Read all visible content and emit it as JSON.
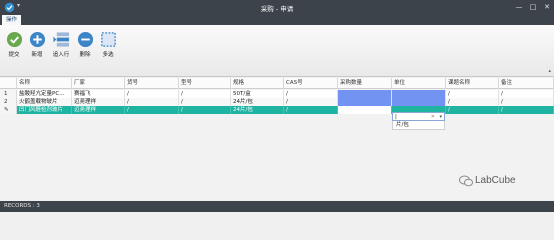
{
  "window": {
    "title": "采购 - 申请",
    "menu_caret": "▾"
  },
  "tabs": [
    {
      "label": "操作"
    }
  ],
  "toolbar": {
    "buttons": [
      {
        "label": "提交",
        "icon": "check-circle-icon",
        "color": "#6aa84f"
      },
      {
        "label": "新增",
        "icon": "plus-circle-icon",
        "color": "#3d85c6"
      },
      {
        "label": "追入行",
        "icon": "insert-row-icon",
        "color": "#3d85c6"
      },
      {
        "label": "删除",
        "icon": "minus-circle-icon",
        "color": "#3d85c6"
      },
      {
        "label": "多选",
        "icon": "multi-select-icon",
        "color": "#3d85c6"
      }
    ]
  },
  "table": {
    "columns": [
      "名称",
      "厂家",
      "货号",
      "型号",
      "规格",
      "CAS号",
      "采购数量",
      "单位",
      "课题名称",
      "备注"
    ],
    "rows": [
      {
        "num": "1",
        "cells": [
          "盐酸羟亢定量PC...",
          "赛福飞",
          "/",
          "/",
          "50T/盒",
          "/",
          "",
          "",
          "/",
          "/"
        ]
      },
      {
        "num": "2",
        "cells": [
          "火鹤盖载物玻片",
          "迈尧理祥",
          "/",
          "/",
          "24片/包",
          "/",
          "",
          "",
          "/",
          "/"
        ]
      },
      {
        "num": "✎",
        "cells": [
          "凹门风醛检剂玻片",
          "迈尧理祥",
          "/",
          "/",
          "24片/包",
          "/",
          "",
          "",
          "/",
          "/"
        ]
      }
    ],
    "selected_row_index": 2
  },
  "unit_dropdown": {
    "value": "|",
    "clear": "✕",
    "arrow": "▾",
    "options": [
      "片/包"
    ]
  },
  "watermark": {
    "text": "LabCube"
  },
  "status": {
    "records": "RECORDS : 3"
  },
  "colors": {
    "accent": "#1fb3a2",
    "highlight_blue": "#7293f2",
    "chrome": "#3d434a"
  }
}
